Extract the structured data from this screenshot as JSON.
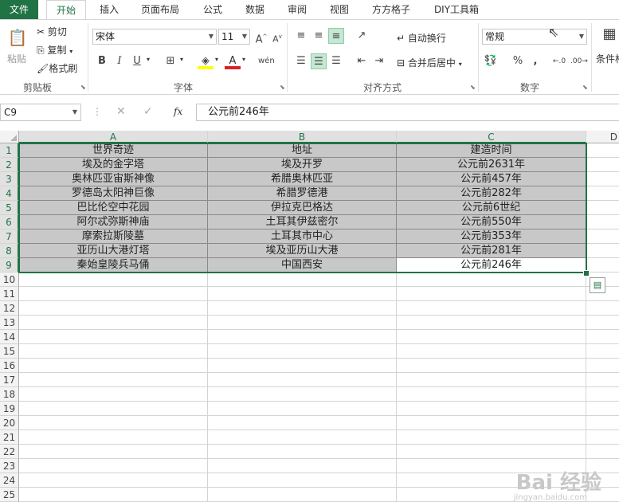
{
  "ribbon_tabs": [
    "文件",
    "开始",
    "插入",
    "页面布局",
    "公式",
    "数据",
    "审阅",
    "视图",
    "方方格子",
    "DIY工具箱"
  ],
  "active_tab": "开始",
  "clipboard": {
    "paste": "粘贴",
    "cut": "剪切",
    "copy": "复制",
    "format_painter": "格式刷",
    "label": "剪贴板"
  },
  "font": {
    "name": "宋体",
    "size": "11",
    "label": "字体",
    "bold": "B",
    "italic": "I",
    "underline": "U"
  },
  "alignment": {
    "wrap_text": "自动换行",
    "merge_center": "合并后居中",
    "label": "对齐方式"
  },
  "number": {
    "format": "常规",
    "percent": "%",
    "comma": ",",
    "label": "数字"
  },
  "styles": {
    "conditional_format": "条件格式"
  },
  "formula_bar": {
    "name_box": "C9",
    "formula": "公元前246年",
    "fx": "fx"
  },
  "columns": [
    "A",
    "B",
    "C",
    "D"
  ],
  "selected_column": "C",
  "rows": [
    [
      "世界奇迹",
      "地址",
      "建造时间"
    ],
    [
      "埃及的金字塔",
      "埃及开罗",
      "公元前2631年"
    ],
    [
      "奥林匹亚宙斯神像",
      "希腊奥林匹亚",
      "公元前457年"
    ],
    [
      "罗德岛太阳神巨像",
      "希腊罗德港",
      "公元前282年"
    ],
    [
      "巴比伦空中花园",
      "伊拉克巴格达",
      "公元前6世纪"
    ],
    [
      "阿尔忒弥斯神庙",
      "土耳其伊兹密尔",
      "公元前550年"
    ],
    [
      "摩索拉斯陵墓",
      "土耳其市中心",
      "公元前353年"
    ],
    [
      "亚历山大港灯塔",
      "埃及亚历山大港",
      "公元前281年"
    ],
    [
      "秦始皇陵兵马俑",
      "中国西安",
      "公元前246年"
    ]
  ],
  "row_numbers": [
    "1",
    "2",
    "3",
    "4",
    "5",
    "6",
    "7",
    "8",
    "9",
    "10",
    "11",
    "12",
    "13",
    "14",
    "15",
    "16",
    "17",
    "18",
    "19",
    "20",
    "21",
    "22",
    "23",
    "24",
    "25"
  ],
  "selected_row": "9",
  "watermark": {
    "brand": "Bai 经验",
    "url": "jingyan.baidu.com"
  },
  "colors": {
    "excel_green": "#217346",
    "shade": "#c8c8c8"
  }
}
